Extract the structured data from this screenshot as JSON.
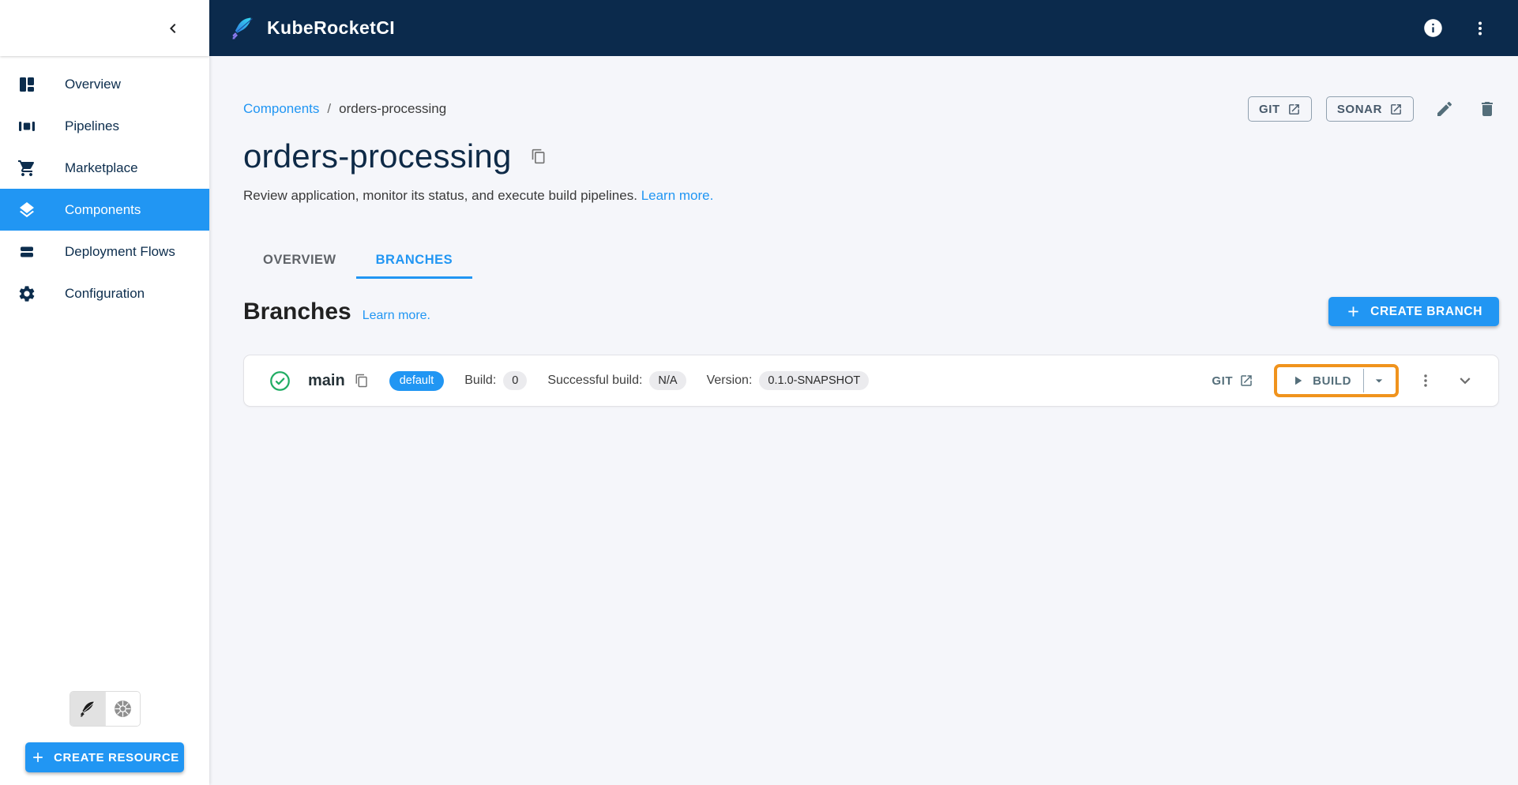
{
  "colors": {
    "accent_blue": "#2196F3",
    "header_navy": "#0B2A4C",
    "sidebar_navy": "#0C2D4D",
    "success_green": "#21AD64",
    "highlight_orange": "#F0931D",
    "slate_action": "#546E7A",
    "page_background": "#F5F6FA"
  },
  "header": {
    "brand": "KubeRocketCI",
    "icons": [
      "chevron-left-icon",
      "quill-logo-icon",
      "info-icon",
      "kebab-menu-icon"
    ]
  },
  "sidebar": {
    "items": [
      {
        "label": "Overview",
        "icon": "dashboard-icon",
        "selected": false
      },
      {
        "label": "Pipelines",
        "icon": "pipelines-icon",
        "selected": false
      },
      {
        "label": "Marketplace",
        "icon": "cart-icon",
        "selected": false
      },
      {
        "label": "Components",
        "icon": "layers-icon",
        "selected": true
      },
      {
        "label": "Deployment Flows",
        "icon": "stacked-bars-icon",
        "selected": false
      },
      {
        "label": "Configuration",
        "icon": "gear-icon",
        "selected": false
      }
    ],
    "footer": {
      "view_toggle_icons": [
        "quill-icon",
        "kubernetes-wheel-icon"
      ],
      "create_button_label": "CREATE RESOURCE"
    }
  },
  "page": {
    "breadcrumb": {
      "parent": "Components",
      "separator": "/",
      "current": "orders-processing"
    },
    "actions": [
      {
        "label": "GIT",
        "icon": "external-link-icon"
      },
      {
        "label": "SONAR",
        "icon": "external-link-icon"
      }
    ],
    "title": "orders-processing",
    "description": "Review application, monitor its status, and execute build pipelines.",
    "learn_more": "Learn more.",
    "tabs": [
      {
        "label": "OVERVIEW",
        "active": false
      },
      {
        "label": "BRANCHES",
        "active": true
      }
    ],
    "section": {
      "title": "Branches",
      "learn_more": "Learn more.",
      "create_button_label": "CREATE BRANCH"
    }
  },
  "branch": {
    "status_icon": "check-circle-icon",
    "name": "main",
    "default_chip": "default",
    "stats": [
      {
        "label": "Build:",
        "value": "0"
      },
      {
        "label": "Successful build:",
        "value": "N/A"
      },
      {
        "label": "Version:",
        "value": "0.1.0-SNAPSHOT"
      }
    ],
    "git_label": "GIT",
    "build_label": "BUILD"
  }
}
